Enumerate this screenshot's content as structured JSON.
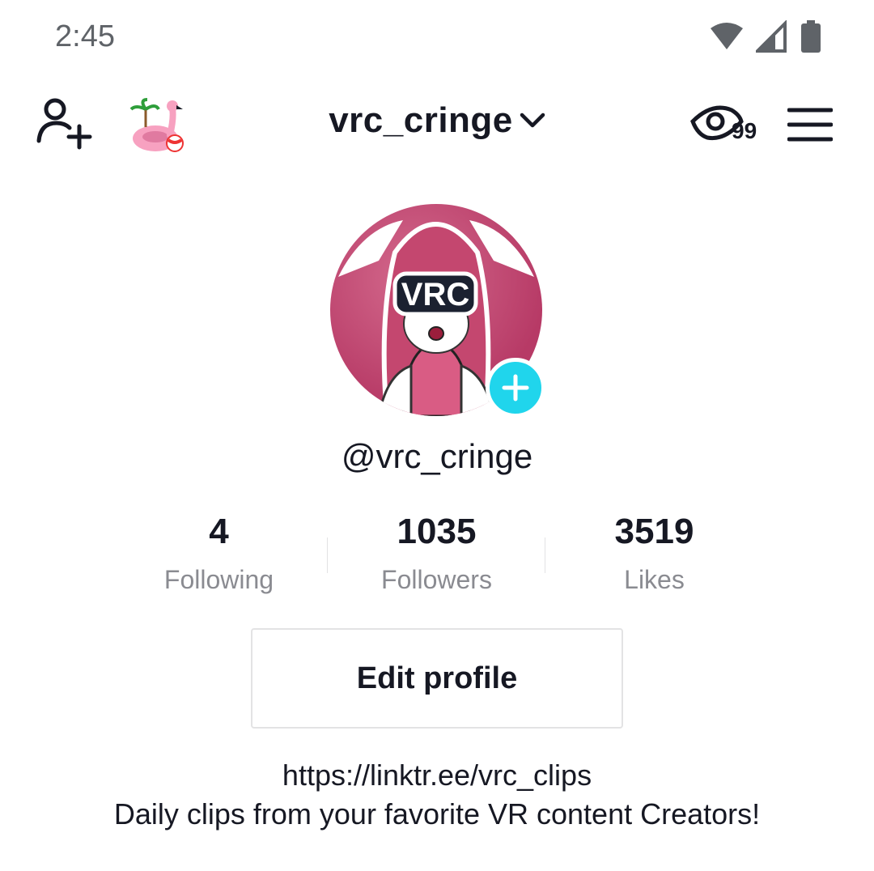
{
  "status_bar": {
    "time": "2:45",
    "icons": [
      "wifi-icon",
      "signal-icon",
      "battery-icon"
    ]
  },
  "top_nav": {
    "username": "vrc_cringe",
    "views_count": "99",
    "icons": [
      "add-user-icon",
      "flamingo-float-icon",
      "chevron-down-icon",
      "eye-icon",
      "hamburger-menu-icon"
    ]
  },
  "profile": {
    "avatar_text": "VRC",
    "handle": "@vrc_cringe"
  },
  "stats": [
    {
      "value": "4",
      "label": "Following"
    },
    {
      "value": "1035",
      "label": "Followers"
    },
    {
      "value": "3519",
      "label": "Likes"
    }
  ],
  "edit_button": {
    "label": "Edit profile"
  },
  "bio": {
    "link": "https://linktr.ee/vrc_clips",
    "description": "Daily clips from your favorite VR content Creators!"
  },
  "colors": {
    "text": "#161823",
    "secondary_text": "#8a8b91",
    "accent": "#20d5ec",
    "avatar_pink": "#c14a75"
  }
}
